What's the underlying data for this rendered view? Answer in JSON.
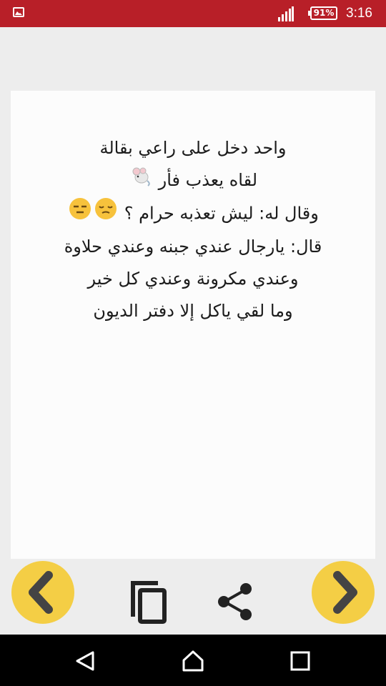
{
  "status_bar": {
    "battery_text": "91%",
    "battery_level": 91,
    "time": "3:16",
    "background_color": "#b81f28"
  },
  "post": {
    "lines": [
      "واحد دخل على راعي بقالة",
      "لقاه يعذب فأر",
      "وقال له: ليش تعذبه حرام ؟",
      "قال: يارجال عندي جبنه وعندي حلاوة",
      "وعندي مكرونة وعندي كل خير",
      "وما لقي ياكل إلا دفتر الديون"
    ],
    "emojis": {
      "line_2": "mouse-emoji",
      "line_3": [
        "unamused-face-emoji",
        "expressionless-face-emoji"
      ]
    }
  },
  "toolbar": {
    "prev_icon": "chevron-left-icon",
    "copy_icon": "copy-icon",
    "share_icon": "share-icon",
    "next_icon": "chevron-right-icon",
    "accent_color": "#f4ce45"
  },
  "nav_bar": {
    "icons": [
      "back-icon",
      "home-icon",
      "recents-icon"
    ]
  }
}
